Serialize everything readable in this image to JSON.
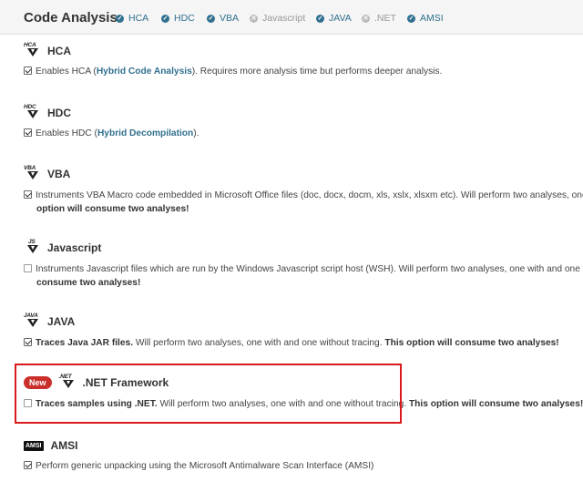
{
  "header": {
    "title": "Code Analysis",
    "tabs": [
      {
        "label": "HCA",
        "enabled": true
      },
      {
        "label": "HDC",
        "enabled": true
      },
      {
        "label": "VBA",
        "enabled": true
      },
      {
        "label": "Javascript",
        "enabled": false
      },
      {
        "label": "JAVA",
        "enabled": true
      },
      {
        "label": ".NET",
        "enabled": false
      },
      {
        "label": "AMSI",
        "enabled": true
      }
    ]
  },
  "sections": {
    "hca": {
      "logo": "HCA",
      "name": "HCA",
      "checked": true,
      "text_pre": "Enables HCA (",
      "link": "Hybrid Code Analysis",
      "text_post": "). Requires more analysis time but performs deeper analysis."
    },
    "hdc": {
      "logo": "HDC",
      "name": "HDC",
      "checked": true,
      "text_pre": "Enables HDC (",
      "link": "Hybrid Decompilation",
      "text_post": ")."
    },
    "vba": {
      "logo": "VBA",
      "name": "VBA",
      "checked": true,
      "line1": "Instruments VBA Macro code embedded in Microsoft Office files (doc, docx, docm, xls, xslx, xlsxm etc). Will perform two analyses, one w",
      "line2": "option will consume two analyses!"
    },
    "javascript": {
      "logo": "JS",
      "name": "Javascript",
      "checked": false,
      "line1": "Instruments Javascript files which are run by the Windows Javascript script host (WSH). Will perform two analyses, one with and one wit",
      "line2": "consume two analyses!"
    },
    "java": {
      "logo": "JAVA",
      "name": "JAVA",
      "checked": true,
      "bold_pre": "Traces Java JAR files.",
      "text": " Will perform two analyses, one with and one without tracing. ",
      "bold_post": "This option will consume two analyses!"
    },
    "dotnet": {
      "badge": "New",
      "logo": ".NET",
      "name": ".NET Framework",
      "checked": false,
      "bold_pre": "Traces samples using .NET.",
      "text": " Will perform two analyses, one with and one without tracing. ",
      "bold_post": "This option will consume two analyses!"
    },
    "amsi": {
      "logo": "AMSI",
      "name": "AMSI",
      "checked": true,
      "text": "Perform generic unpacking using the Microsoft Antimalware Scan Interface (AMSI)"
    }
  },
  "colors": {
    "link": "#31708f",
    "badge": "#c9302c",
    "highlight": "#d9191c"
  }
}
